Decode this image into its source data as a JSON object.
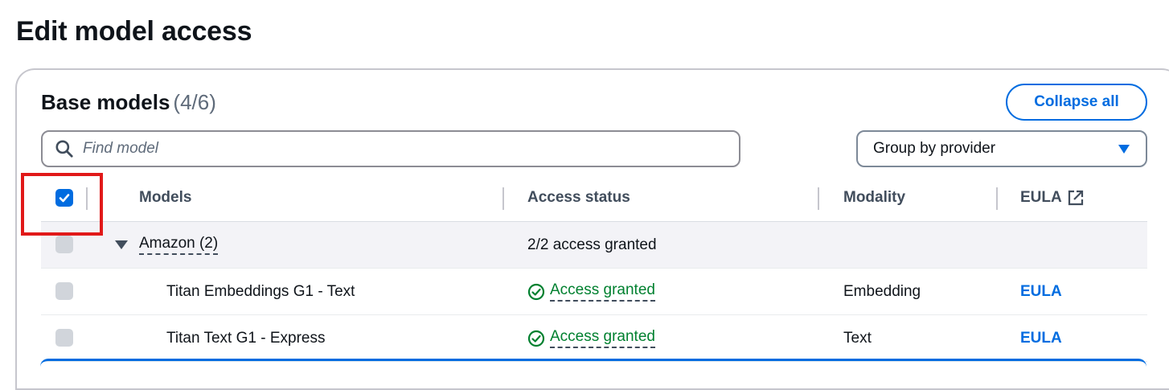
{
  "page": {
    "title": "Edit model access"
  },
  "section": {
    "title": "Base models",
    "count": "(4/6)",
    "collapse_label": "Collapse all"
  },
  "search": {
    "placeholder": "Find model",
    "value": ""
  },
  "group_select": {
    "selected": "Group by provider"
  },
  "table": {
    "headers": {
      "models": "Models",
      "access_status": "Access status",
      "modality": "Modality",
      "eula": "EULA"
    },
    "select_all_checked": true,
    "group": {
      "name": "Amazon (2)",
      "status": "2/2 access granted",
      "expanded": true
    },
    "rows": [
      {
        "model": "Titan Embeddings G1 - Text",
        "status": "Access granted",
        "modality": "Embedding",
        "eula": "EULA"
      },
      {
        "model": "Titan Text G1 - Express",
        "status": "Access granted",
        "modality": "Text",
        "eula": "EULA"
      }
    ]
  },
  "colors": {
    "accent": "#006ce0",
    "success": "#00802f",
    "highlight": "#e11919"
  },
  "icons": {
    "search": "search-icon",
    "caret": "caret-down-icon",
    "external": "external-link-icon",
    "check": "check-circle-icon"
  }
}
